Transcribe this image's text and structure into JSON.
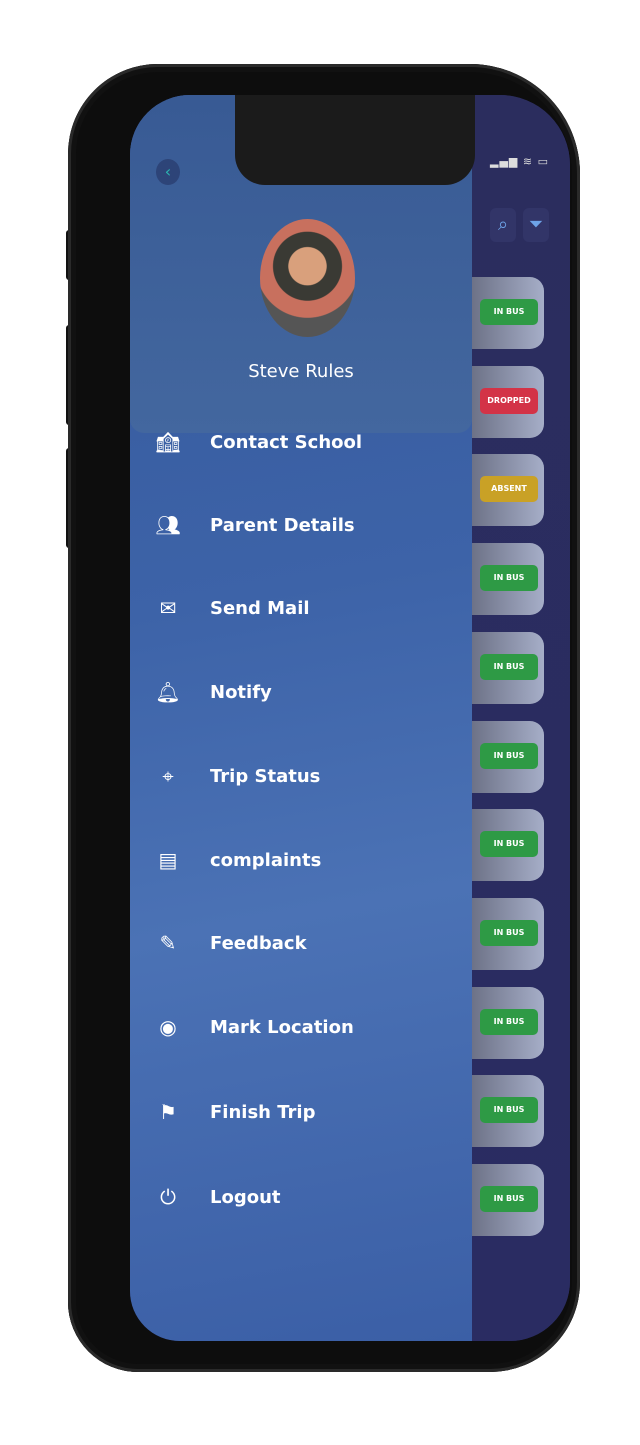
{
  "user": {
    "name": "Steve Rules"
  },
  "menu": [
    {
      "label": "Contact School",
      "icon": "school-icon"
    },
    {
      "label": "Parent Details",
      "icon": "parents-icon"
    },
    {
      "label": "Send Mail",
      "icon": "mail-icon"
    },
    {
      "label": "Notify",
      "icon": "bell-icon"
    },
    {
      "label": "Trip Status",
      "icon": "map-pin-icon"
    },
    {
      "label": "complaints",
      "icon": "document-icon"
    },
    {
      "label": "Feedback",
      "icon": "feedback-pen-icon"
    },
    {
      "label": "Mark Location",
      "icon": "location-icon"
    },
    {
      "label": "Finish Trip",
      "icon": "checkered-flag-icon"
    },
    {
      "label": "Logout",
      "icon": "power-icon"
    }
  ],
  "students": [
    {
      "status": "IN BUS"
    },
    {
      "status": "DROPPED"
    },
    {
      "status": "ABSENT"
    },
    {
      "status": "IN BUS"
    },
    {
      "status": "IN BUS"
    },
    {
      "status": "IN BUS"
    },
    {
      "status": "IN BUS"
    },
    {
      "status": "IN BUS"
    },
    {
      "status": "IN BUS"
    },
    {
      "status": "IN BUS"
    },
    {
      "status": "IN BUS"
    }
  ],
  "colors": {
    "in_bus": "#2e9a45",
    "dropped": "#d33347",
    "absent": "#c9a126",
    "drawer": "#3d63a8",
    "back_arrow": "#2bb5b0"
  }
}
